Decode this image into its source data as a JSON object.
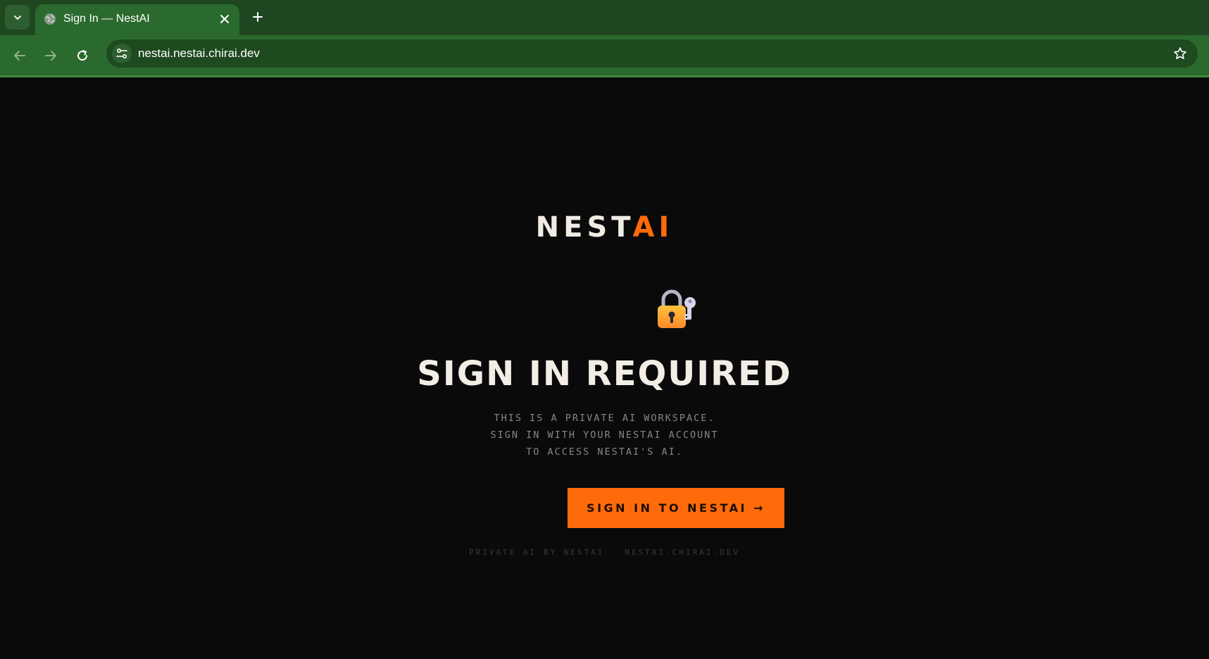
{
  "browser": {
    "tab": {
      "title": "Sign In — NestAI",
      "favicon": "globe-icon"
    },
    "url": "nestai.nestai.chirai.dev",
    "colors": {
      "tabstrip": "#1e4620",
      "toolbar": "#2b6a2e",
      "omnibox": "#1e4a20"
    }
  },
  "page": {
    "logo": {
      "part1": "NEST",
      "part2": "AI"
    },
    "icon": "locked-with-key-icon",
    "headline": "SIGN IN REQUIRED",
    "subtext": [
      "THIS IS A PRIVATE AI WORKSPACE.",
      "SIGN IN WITH YOUR NESTAI ACCOUNT",
      "TO ACCESS NESTAI'S AI."
    ],
    "cta_label": "SIGN IN TO NESTAI →",
    "footer": "PRIVATE AI BY NESTAI · NESTAI.CHIRAI.DEV",
    "colors": {
      "accent": "#ff6b0a",
      "background": "#0a0a0a",
      "text": "#f2eee6"
    }
  }
}
